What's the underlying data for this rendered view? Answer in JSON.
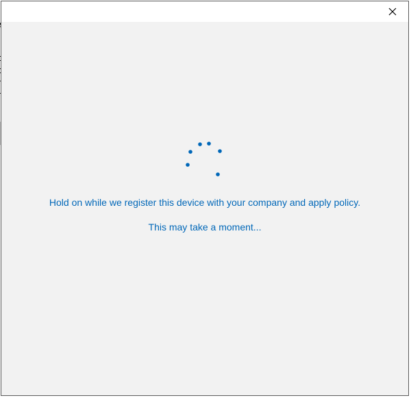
{
  "dialog": {
    "close_icon": "close-icon",
    "message": "Hold on while we register this device with your company and apply policy.",
    "submessage": "This may take a moment...",
    "spinner_icon": "loading-spinner-icon"
  },
  "background_window": {
    "glyphs": [
      "A",
      "c",
      "c",
      "n",
      "n"
    ]
  },
  "colors": {
    "accent": "#0067b8",
    "dialog_background": "#f2f2f2",
    "titlebar_background": "#ffffff"
  }
}
